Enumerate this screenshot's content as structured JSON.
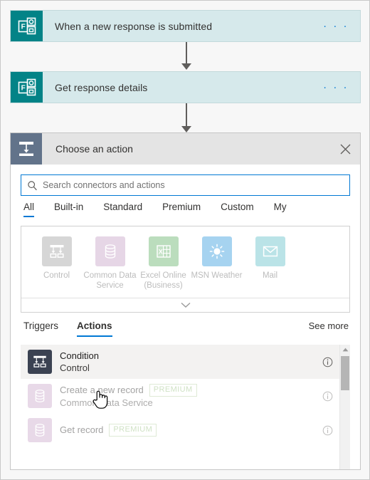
{
  "flow": {
    "steps": [
      {
        "title": "When a new response is submitted",
        "icon": "microsoft-forms-icon",
        "menu": "· · ·"
      },
      {
        "title": "Get response details",
        "icon": "microsoft-forms-icon",
        "menu": "· · ·"
      }
    ]
  },
  "picker": {
    "title": "Choose an action",
    "header_icon": "control-icon",
    "close_label": "✕",
    "search": {
      "placeholder": "Search connectors and actions",
      "value": "",
      "icon": "search-icon"
    },
    "filter_tabs": [
      {
        "label": "All",
        "active": true
      },
      {
        "label": "Built-in",
        "active": false
      },
      {
        "label": "Standard",
        "active": false
      },
      {
        "label": "Premium",
        "active": false
      },
      {
        "label": "Custom",
        "active": false
      },
      {
        "label": "My",
        "active": false
      }
    ],
    "connectors": [
      {
        "name": "Control",
        "icon": "control-icon",
        "tile_color": "#a6a6a6"
      },
      {
        "name": "Common Data Service",
        "icon": "database-icon",
        "tile_color": "#c9a5c9"
      },
      {
        "name": "Excel Online (Business)",
        "icon": "excel-icon",
        "tile_color": "#6ab46f"
      },
      {
        "name": "MSN Weather",
        "icon": "sun-icon",
        "tile_color": "#3b9ee0"
      },
      {
        "name": "Mail",
        "icon": "envelope-icon",
        "tile_color": "#67c3cc"
      }
    ],
    "expander_icon": "chevron-down-icon",
    "sub_tabs": [
      {
        "label": "Triggers",
        "active": false
      },
      {
        "label": "Actions",
        "active": true
      }
    ],
    "see_more_label": "See more",
    "results": [
      {
        "title": "Condition",
        "subtitle": "Control",
        "badge": "",
        "icon": "control-icon",
        "tile_color": "#3b4252",
        "selected": true,
        "dim": false,
        "info_icon": "info-icon"
      },
      {
        "title": "Create a new record",
        "subtitle": "Common Data Service",
        "badge": "PREMIUM",
        "icon": "database-icon",
        "tile_color": "#c9a5c9",
        "selected": false,
        "dim": true,
        "info_icon": "info-icon"
      },
      {
        "title": "Get record",
        "subtitle": "",
        "badge": "PREMIUM",
        "icon": "database-icon",
        "tile_color": "#c9a5c9",
        "selected": false,
        "dim": true,
        "info_icon": "info-icon"
      }
    ],
    "scrollbar": {
      "up_icon": "scroll-up-arrow-icon"
    }
  },
  "colors": {
    "forms_teal": "#038387",
    "card_fill": "#d6e9eb",
    "accent_blue": "#0078d4",
    "header_gray": "#e4e4e4",
    "premium_green": "#8cb973"
  },
  "cursor": {
    "type": "pointer-hand-cursor"
  }
}
